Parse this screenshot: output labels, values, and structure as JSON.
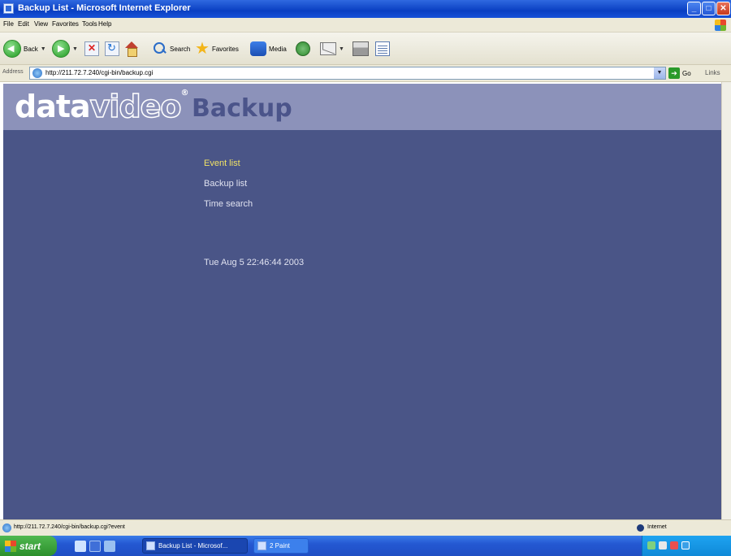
{
  "window": {
    "title": "Backup List - Microsoft Internet Explorer"
  },
  "menubar": {
    "items": [
      "File",
      "Edit",
      "View",
      "Favorites",
      "Tools",
      "Help"
    ]
  },
  "toolbar": {
    "back_label": "Back",
    "search_label": "Search",
    "favorites_label": "Favorites",
    "media_label": "Media"
  },
  "addressbar": {
    "label": "Address",
    "url": "http://211.72.7.240/cgi-bin/backup.cgi",
    "go_label": "Go",
    "links_label": "Links"
  },
  "page": {
    "logo_data": "data",
    "logo_video": "video",
    "title": "Backup",
    "nav": [
      {
        "label": "Event list",
        "active": true
      },
      {
        "label": "Backup list",
        "active": false
      },
      {
        "label": "Time search",
        "active": false
      }
    ],
    "datetime": "Tue Aug 5 22:46:44 2003"
  },
  "statusbar": {
    "text": "http://211.72.7.240/cgi-bin/backup.cgi?event",
    "zone": "Internet"
  },
  "taskbar": {
    "start_label": "start",
    "tasks": [
      {
        "label": "Backup List - Microsof..."
      },
      {
        "label": "2 Paint"
      }
    ],
    "clock": ""
  },
  "colors": {
    "page_bg": "#4a5587",
    "header_bg": "#8c92ba",
    "active_link": "#f1e266",
    "link": "#e0e2f0",
    "title": "#4b548a"
  }
}
